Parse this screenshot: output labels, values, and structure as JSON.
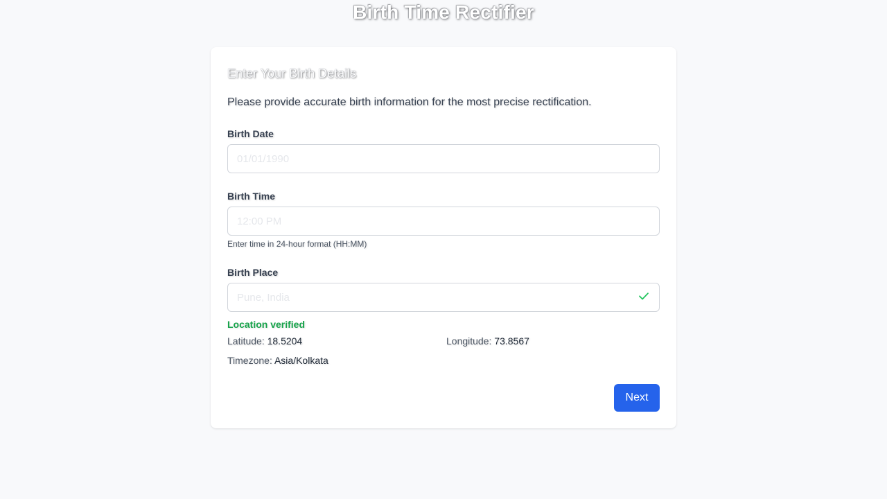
{
  "app": {
    "title": "Birth Time Rectifier"
  },
  "form": {
    "heading": "Enter Your Birth Details",
    "intro": "Please provide accurate birth information for the most precise rectification.",
    "birth_date": {
      "label": "Birth Date",
      "value": "",
      "placeholder": "01/01/1990"
    },
    "birth_time": {
      "label": "Birth Time",
      "value": "",
      "placeholder": "12:00 PM",
      "hint": "Enter time in 24-hour format (HH:MM)"
    },
    "birth_place": {
      "label": "Birth Place",
      "value": "",
      "placeholder": "Pune, India",
      "status_icon": "check-icon"
    },
    "location": {
      "status": "Location verified",
      "latitude_label": "Latitude:",
      "latitude_value": "18.5204",
      "longitude_label": "Longitude:",
      "longitude_value": "73.8567",
      "timezone_label": "Timezone:",
      "timezone_value": "Asia/Kolkata"
    },
    "next_label": "Next"
  },
  "colors": {
    "accent": "#2563eb",
    "success": "#16a34a",
    "background": "#f8f9fb"
  }
}
